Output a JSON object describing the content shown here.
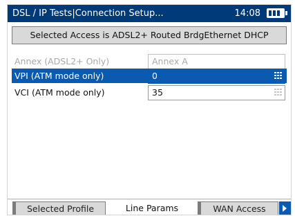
{
  "header": {
    "title": "DSL / IP Tests|Connection Setup...",
    "time": "14:08",
    "battery_icon": "battery-icon"
  },
  "access_banner": "Selected Access  is ADSL2+ Routed BrdgEthernet DHCP",
  "params": [
    {
      "label": "Annex (ADSL2+ Only)",
      "value": "Annex A",
      "state": "disabled"
    },
    {
      "label": "VPI (ATM mode only)",
      "value": "0",
      "state": "selected"
    },
    {
      "label": "VCI (ATM mode only)",
      "value": "35",
      "state": "normal"
    }
  ],
  "tabs": [
    {
      "label": "Selected Profile"
    },
    {
      "label": "Line Params",
      "active": true
    },
    {
      "label": "WAN Access"
    }
  ],
  "colors": {
    "title_bar": "#003a78",
    "selection": "#0a5ab2",
    "banner_bg": "#d9d9d9"
  }
}
